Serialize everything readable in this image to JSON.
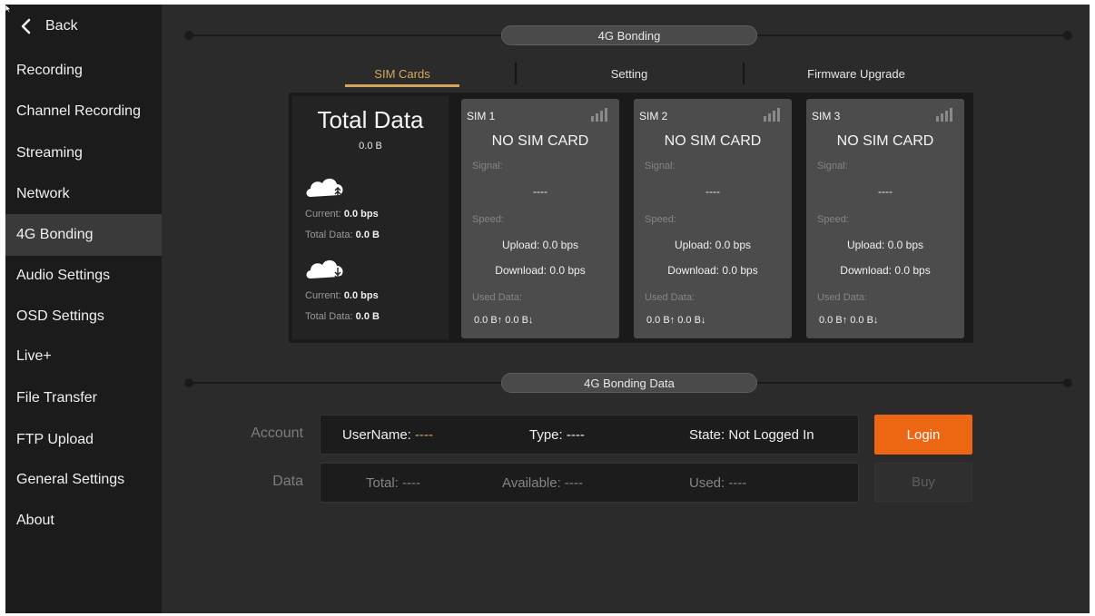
{
  "sidebar": {
    "back_label": "Back",
    "items": [
      {
        "label": "Recording"
      },
      {
        "label": "Channel Recording"
      },
      {
        "label": "Streaming"
      },
      {
        "label": "Network"
      },
      {
        "label": "4G Bonding",
        "active": true
      },
      {
        "label": "Audio Settings"
      },
      {
        "label": "OSD Settings"
      },
      {
        "label": "Live+"
      },
      {
        "label": "File Transfer"
      },
      {
        "label": "FTP Upload"
      },
      {
        "label": "General Settings"
      },
      {
        "label": "About"
      }
    ]
  },
  "section_title": "4G Bonding",
  "tabs": [
    {
      "label": "SIM Cards",
      "active": true
    },
    {
      "label": "Setting"
    },
    {
      "label": "Firmware Upgrade"
    }
  ],
  "total": {
    "title": "Total Data",
    "value": "0.0 B",
    "upload": {
      "current_label": "Current:",
      "current_value": "0.0 bps",
      "total_label": "Total Data:",
      "total_value": "0.0 B"
    },
    "download": {
      "current_label": "Current:",
      "current_value": "0.0 bps",
      "total_label": "Total Data:",
      "total_value": "0.0 B"
    }
  },
  "sims": [
    {
      "name": "SIM 1",
      "status": "NO SIM CARD",
      "signal_label": "Signal:",
      "signal_value": "----",
      "speed_label": "Speed:",
      "upload": "Upload: 0.0 bps",
      "download": "Download: 0.0 bps",
      "used_label": "Used Data:",
      "used": "0.0 B↑  0.0 B↓"
    },
    {
      "name": "SIM 2",
      "status": "NO SIM CARD",
      "signal_label": "Signal:",
      "signal_value": "----",
      "speed_label": "Speed:",
      "upload": "Upload: 0.0 bps",
      "download": "Download: 0.0 bps",
      "used_label": "Used Data:",
      "used": "0.0 B↑  0.0 B↓"
    },
    {
      "name": "SIM 3",
      "status": "NO SIM CARD",
      "signal_label": "Signal:",
      "signal_value": "----",
      "speed_label": "Speed:",
      "upload": "Upload: 0.0 bps",
      "download": "Download: 0.0 bps",
      "used_label": "Used Data:",
      "used": "0.0 B↑  0.0 B↓"
    }
  ],
  "bonding_data": {
    "title": "4G Bonding Data",
    "account_label": "Account",
    "username_label": "UserName:",
    "username_value": "----",
    "type": "Type: ----",
    "state": "State: Not Logged In",
    "login_label": "Login",
    "data_label": "Data",
    "total": "Total: ----",
    "available": "Available: ----",
    "used": "Used: ----",
    "buy_label": "Buy"
  },
  "colors": {
    "accent": "#ed6613",
    "tab_active": "#d8a85a",
    "sidebar_bg": "#1b1b1b",
    "main_bg": "#2b2b2b"
  },
  "icons": [
    "back-chevron-icon",
    "signal-bars-icon",
    "cloud-upload-icon",
    "cloud-download-icon",
    "mouse-cursor-icon"
  ]
}
